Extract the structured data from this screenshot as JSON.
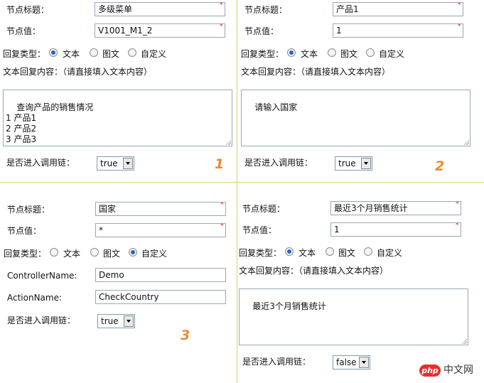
{
  "common": {
    "title_label": "节点标题：",
    "value_label": "节点值：",
    "reply_type_label": "回复类型：",
    "reply_text": "文本",
    "reply_image": "图文",
    "reply_custom": "自定义",
    "text_content_label": "文本回复内容：（请直接填入文本内容）",
    "chain_label": "是否进入调用链："
  },
  "panels": {
    "p1": {
      "title": "多级菜单",
      "value": "V1001_M1_2",
      "reply_type": "文本",
      "text": "查询产品的销售情况\n1 产品1\n2 产品2\n3 产品3",
      "chain": "true",
      "index": "1"
    },
    "p2": {
      "title": "产品1",
      "value": "1",
      "reply_type": "文本",
      "text": "请输入国家",
      "chain": "true",
      "index": "2"
    },
    "p3": {
      "title": "国家",
      "value": "*",
      "reply_type": "自定义",
      "controller_label": "ControllerName:",
      "controller": "Demo",
      "action_label": "ActionName:",
      "action": "CheckCountry",
      "chain": "true",
      "index": "3"
    },
    "p4": {
      "title": "最近3个月销售统计",
      "value": "1",
      "reply_type": "文本",
      "text": "最近3个月销售统计",
      "chain": "false"
    }
  },
  "watermark": {
    "brand": "php",
    "text": "中文网"
  },
  "colors": {
    "divider": "#d9d36a",
    "required": "#e01010",
    "index_number": "#f08a2a",
    "watermark_red": "#e0332c"
  }
}
